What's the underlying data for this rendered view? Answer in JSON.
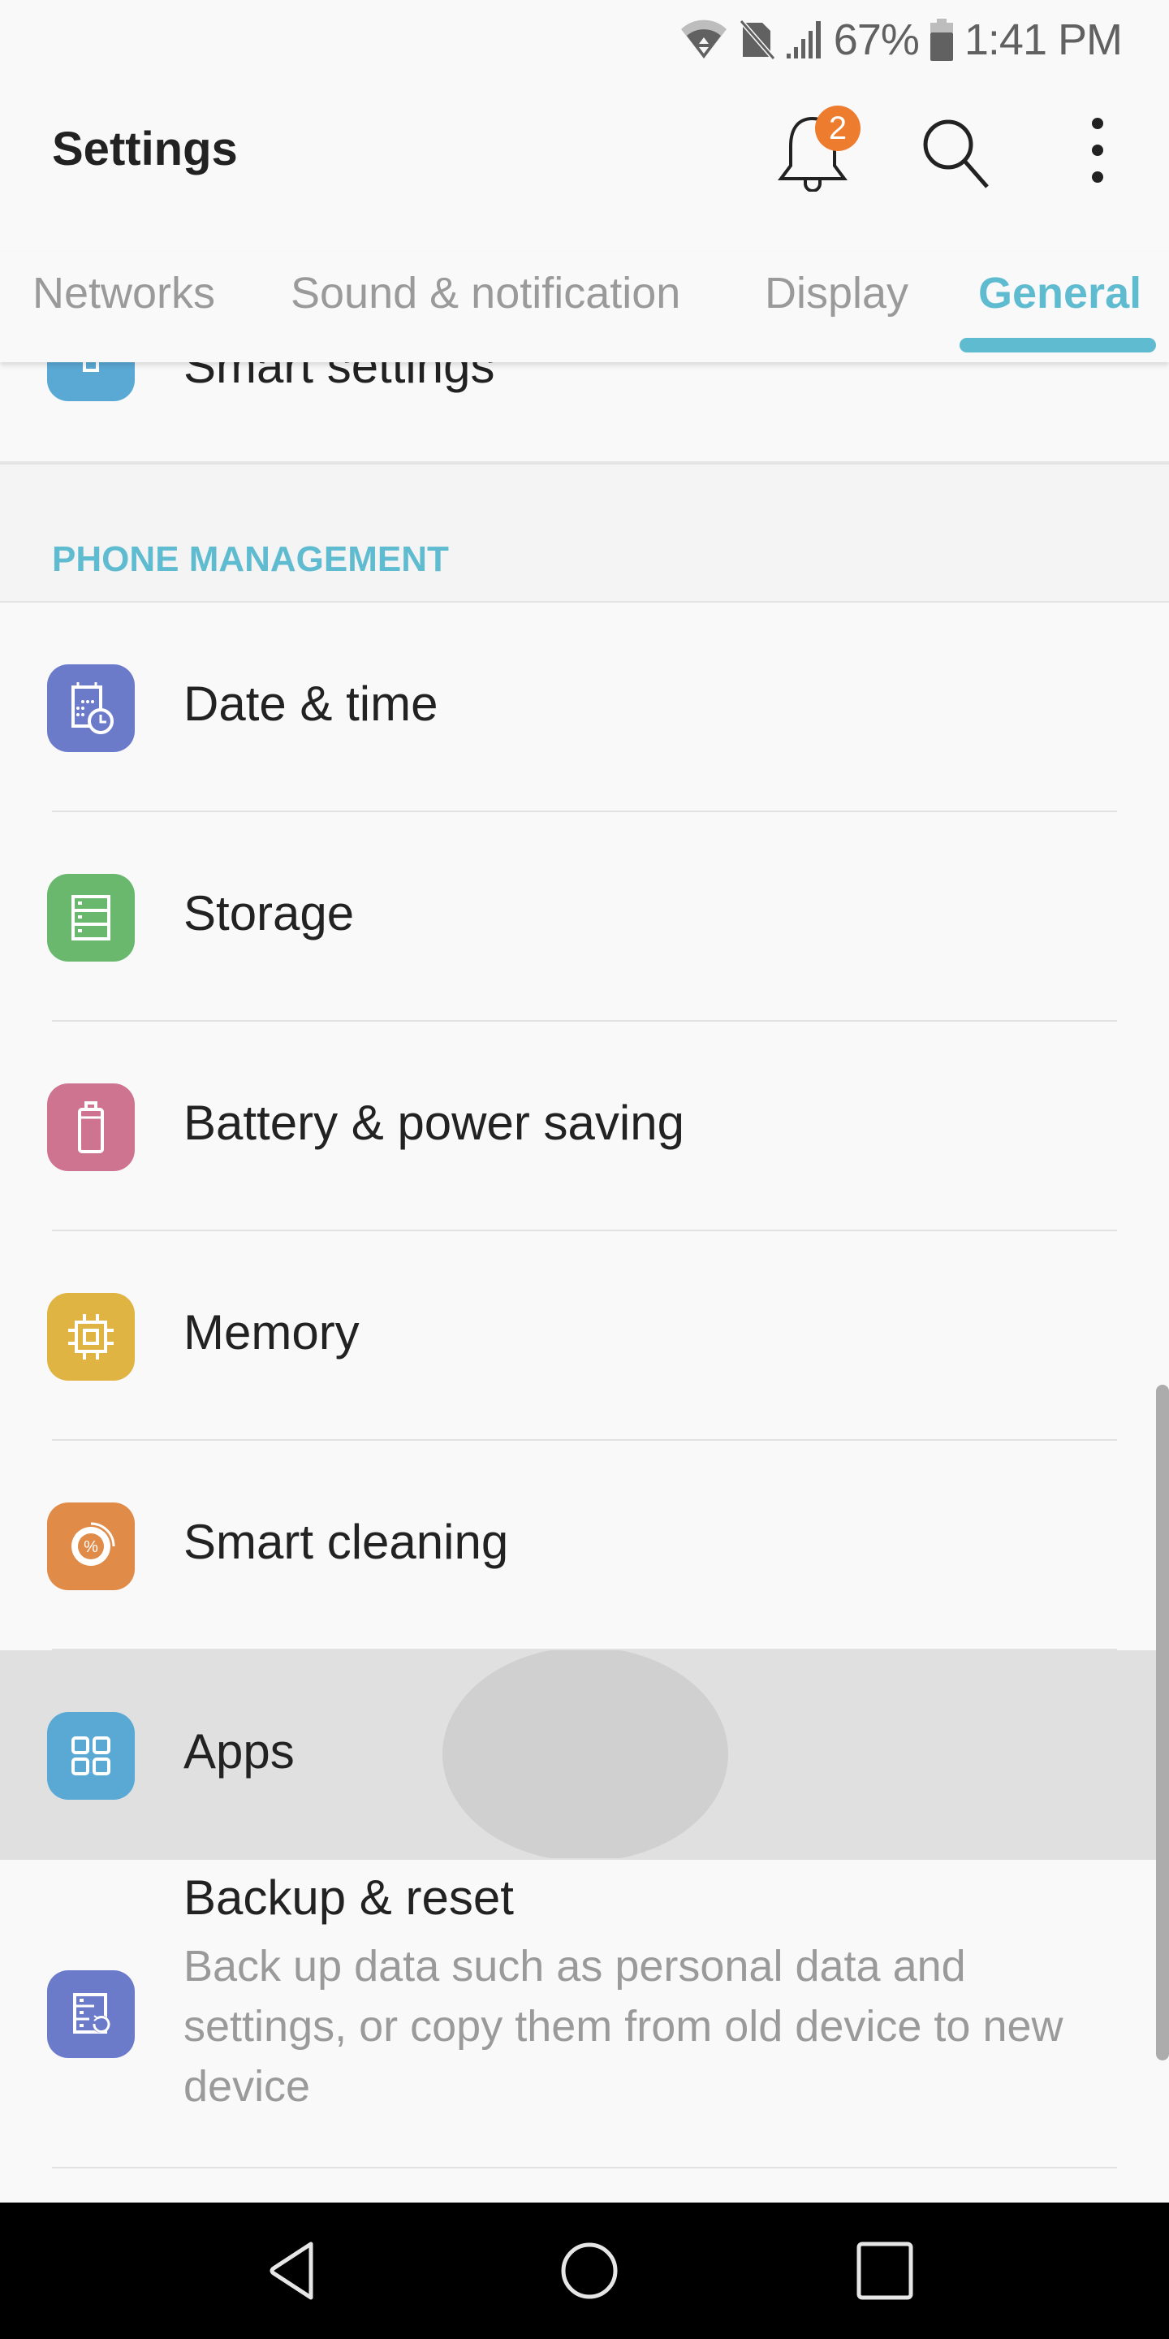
{
  "status_bar": {
    "battery_percent": "67%",
    "time": "1:41 PM",
    "icons": [
      "wifi-icon",
      "no-sim-icon",
      "signal-icon",
      "battery-icon"
    ]
  },
  "app_bar": {
    "title": "Settings",
    "notification_count": "2",
    "actions": [
      "bell-icon",
      "search-icon",
      "more-vert-icon"
    ]
  },
  "tabs": [
    {
      "label": "Networks",
      "active": false
    },
    {
      "label": "Sound & notification",
      "active": false
    },
    {
      "label": "Display",
      "active": false
    },
    {
      "label": "General",
      "active": true
    }
  ],
  "accent_color": "#5fbcd0",
  "content": {
    "partial_item": {
      "label": "Smart settings",
      "icon": "smart-settings-icon",
      "color": "#5aa9d4"
    },
    "section_title": "PHONE MANAGEMENT",
    "items": [
      {
        "label": "Date & time",
        "icon": "calendar-clock-icon",
        "color": "#6b7bc9"
      },
      {
        "label": "Storage",
        "icon": "storage-icon",
        "color": "#69b86d"
      },
      {
        "label": "Battery & power saving",
        "icon": "battery-icon",
        "color": "#cf7490"
      },
      {
        "label": "Memory",
        "icon": "chip-icon",
        "color": "#e0b443"
      },
      {
        "label": "Smart cleaning",
        "icon": "smart-cleaning-icon",
        "color": "#e08c48"
      },
      {
        "label": "Apps",
        "icon": "apps-grid-icon",
        "color": "#5aa9d4",
        "pressed": true
      },
      {
        "label": "Backup & reset",
        "summary": "Back up data such as personal data and settings, or copy them from old device to new device",
        "icon": "backup-icon",
        "color": "#6b7bc9"
      }
    ]
  },
  "nav_bar": {
    "buttons": [
      "back-icon",
      "home-icon",
      "recents-icon"
    ]
  }
}
